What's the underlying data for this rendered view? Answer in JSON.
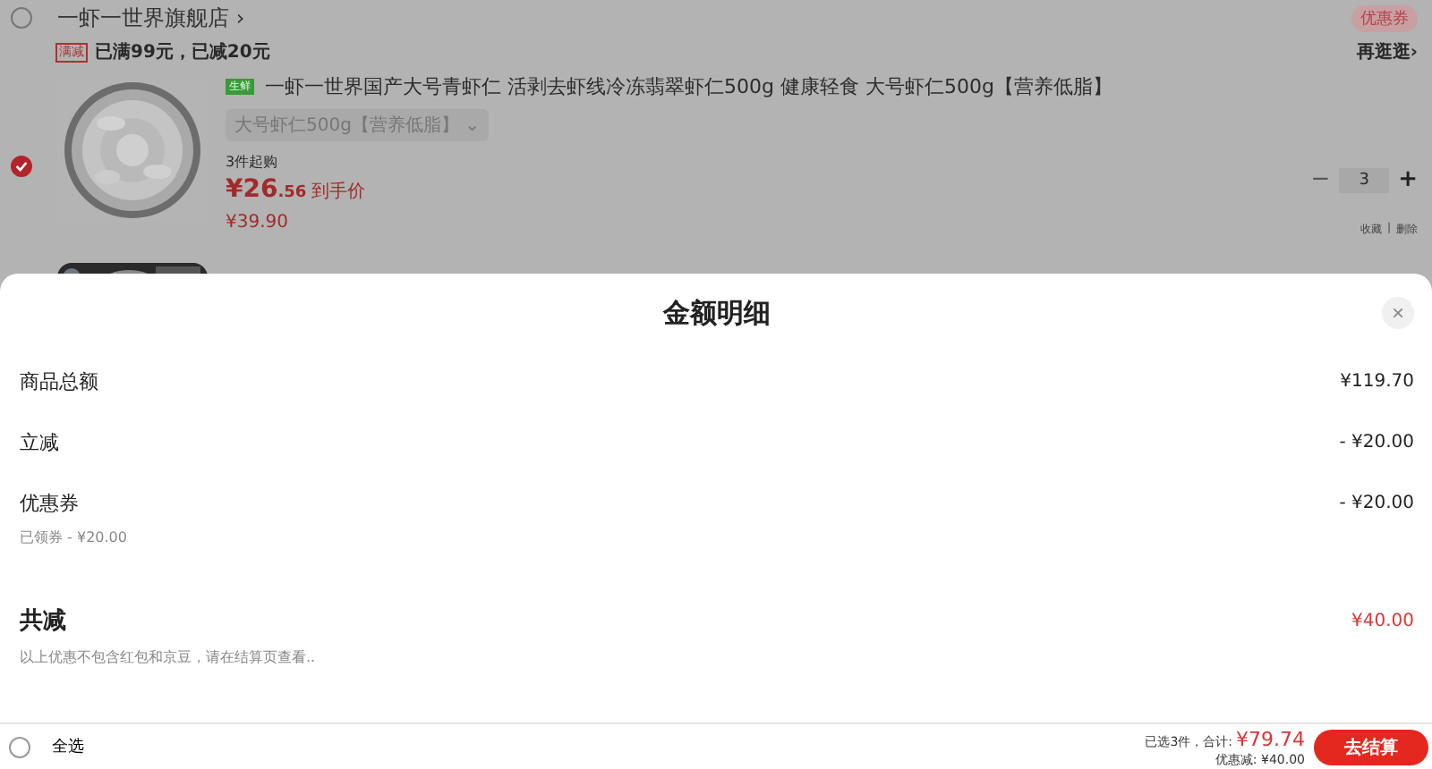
{
  "store": {
    "name": "一虾一世界旗舰店",
    "arrow": "›",
    "checked": false,
    "coupon_badge": "优惠券"
  },
  "promo": {
    "tag": "满减",
    "text": "已满99元，已减20元",
    "link": "再逛逛",
    "link_arrow": "›"
  },
  "items": [
    {
      "checked": true,
      "badge": "生鲜",
      "title": "一虾一世界国产大号青虾仁 活剥去虾线冷冻翡翠虾仁500g 健康轻食 大号虾仁500g【营养低脂】",
      "spec": "大号虾仁500g【营养低脂】",
      "spec_caret": "⌄",
      "min_qty": "3件起购",
      "price_int": "¥26",
      "price_dec": ".56",
      "price_note": "到手价",
      "original_price": "¥39.90",
      "minus": "−",
      "qty": "3",
      "plus": "+",
      "actions": [
        "收藏",
        "删除"
      ],
      "actions_sep": "|"
    }
  ],
  "modal": {
    "title": "金额明细",
    "close": "×",
    "rows": [
      {
        "label": "商品总额",
        "value": "¥119.70"
      },
      {
        "label": "立减",
        "value": "- ¥20.00"
      },
      {
        "label": "优惠券",
        "value": "- ¥20.00",
        "sub": "已领券 - ¥20.00"
      }
    ],
    "total": {
      "label": "共减",
      "value": "¥40.00",
      "note": "以上优惠不包含红包和京豆，请在结算页查看.."
    }
  },
  "footer": {
    "select_all": {
      "label": "全选",
      "checked": false
    },
    "summary": "已选3件，合计:",
    "total": "¥79.74",
    "discount": "优惠减: ¥40.00",
    "checkout": "去结算"
  }
}
